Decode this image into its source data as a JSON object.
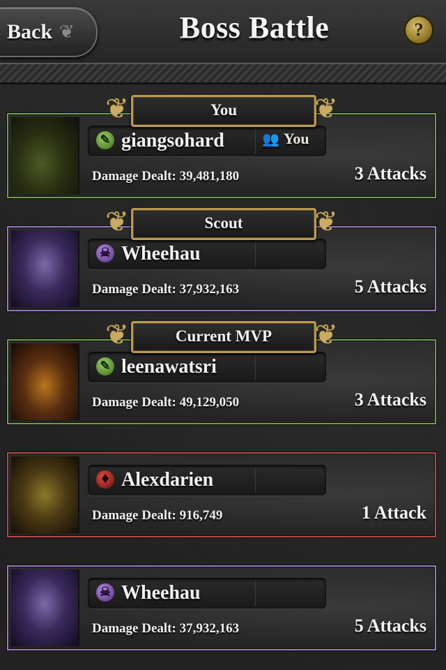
{
  "header": {
    "back_label": "Back",
    "title": "Boss Battle",
    "help_symbol": "?"
  },
  "banners": {
    "you": "You",
    "scout": "Scout",
    "mvp": "Current MVP"
  },
  "rows": [
    {
      "name": "giangsohard",
      "faction": "green-leaf-icon",
      "faction_glyph": "✎",
      "you_tag": "You",
      "damage": "Damage Dealt: 39,481,180",
      "attacks": "3 Attacks"
    },
    {
      "name": "Wheehau",
      "faction": "purple-skull-icon",
      "faction_glyph": "☠",
      "damage": "Damage Dealt: 37,932,163",
      "attacks": "5 Attacks"
    },
    {
      "name": "leenawatsri",
      "faction": "green-leaf-icon",
      "faction_glyph": "✎",
      "damage": "Damage Dealt: 49,129,050",
      "attacks": "3 Attacks"
    },
    {
      "name": "Alexdarien",
      "faction": "red-flame-icon",
      "faction_glyph": "♦",
      "damage": "Damage Dealt: 916,749",
      "attacks": "1 Attack"
    },
    {
      "name": "Wheehau",
      "faction": "purple-skull-icon",
      "faction_glyph": "☠",
      "damage": "Damage Dealt: 37,932,163",
      "attacks": "5 Attacks"
    }
  ],
  "colors": {
    "green_border": "#6fa04a",
    "purple_border": "#9a78c8",
    "red_border": "#b84a48",
    "gold": "#b89a55"
  }
}
